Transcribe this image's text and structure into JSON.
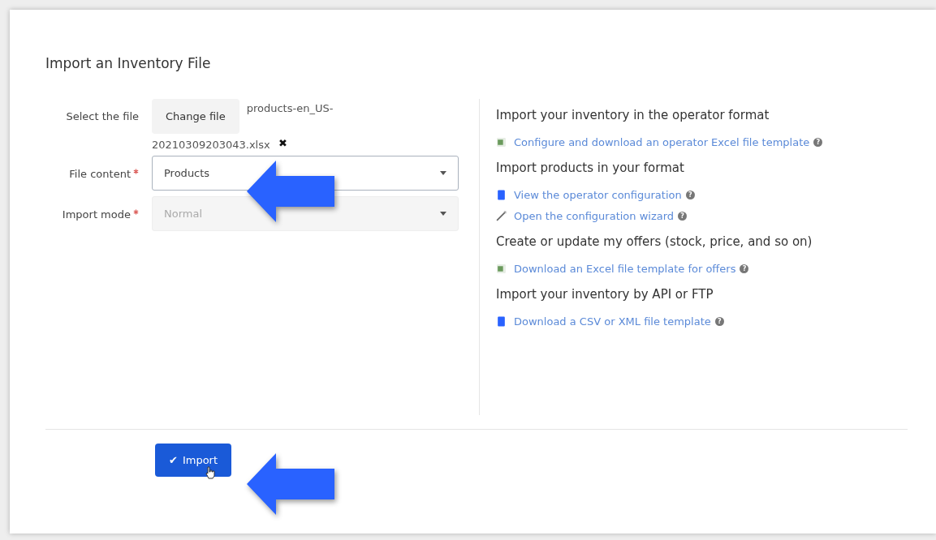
{
  "title": "Import an Inventory File",
  "form": {
    "file": {
      "label": "Select the file",
      "button": "Change file",
      "filename_line_1": "products-en_US-",
      "filename_line_2": "20210309203043.xlsx",
      "remove": "✖"
    },
    "fields": [
      {
        "label": "File content",
        "required": true,
        "value": "Products",
        "disabled": false
      },
      {
        "label": "Import mode",
        "required": true,
        "value": "Normal",
        "disabled": true
      }
    ]
  },
  "sections": [
    {
      "heading": "Import your inventory in the operator format",
      "links": [
        {
          "kind": "excel",
          "text": "Configure and download an operator Excel file template",
          "help": "?"
        }
      ]
    },
    {
      "heading": "Import products in your format",
      "links": [
        {
          "kind": "book",
          "text": "View the operator configuration",
          "help": "?"
        },
        {
          "kind": "wand",
          "text": "Open the configuration wizard",
          "help": "?"
        }
      ]
    },
    {
      "heading": "Create or update my offers (stock, price, and so on)",
      "links": [
        {
          "kind": "excel",
          "text": "Download an Excel file template for offers",
          "help": "?"
        }
      ]
    },
    {
      "heading": "Import your inventory by API or FTP",
      "links": [
        {
          "kind": "book",
          "text": "Download a CSV or XML file template",
          "help": "?"
        }
      ]
    }
  ],
  "submit": {
    "icon": "✔",
    "label": "Import"
  }
}
